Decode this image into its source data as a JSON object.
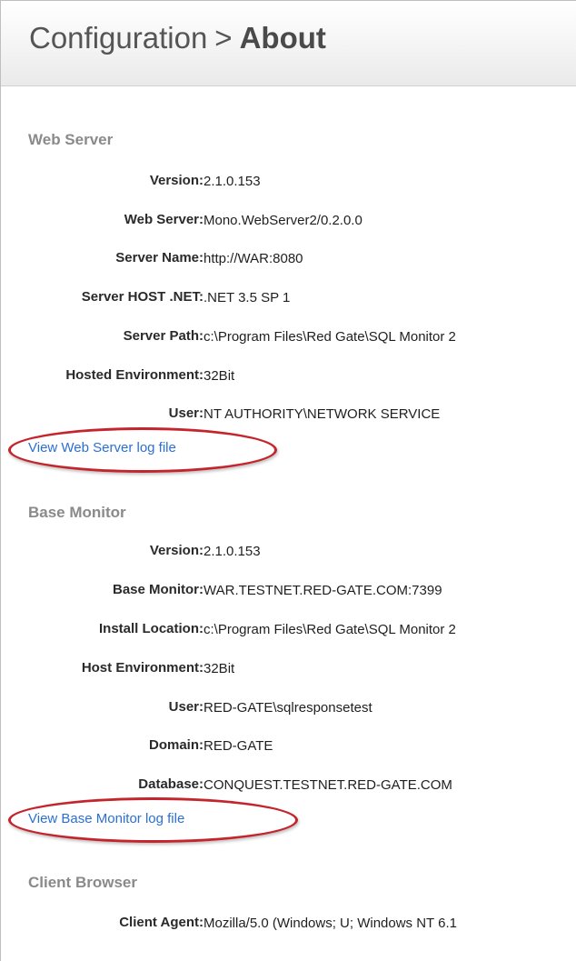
{
  "header": {
    "breadcrumb_parent": "Configuration",
    "breadcrumb_separator": ">",
    "breadcrumb_current": "About"
  },
  "web_server": {
    "title": "Web Server",
    "fields": [
      {
        "label": "Version:",
        "value": "2.1.0.153"
      },
      {
        "label": "Web Server:",
        "value": "Mono.WebServer2/0.2.0.0"
      },
      {
        "label": "Server Name:",
        "value": "http://WAR:8080"
      },
      {
        "label": "Server HOST .NET:",
        "value": ".NET 3.5 SP 1"
      },
      {
        "label": "Server Path:",
        "value": "c:\\Program Files\\Red Gate\\SQL Monitor 2"
      },
      {
        "label": "Hosted Environment:",
        "value": "32Bit"
      },
      {
        "label": "User:",
        "value": "NT AUTHORITY\\NETWORK SERVICE"
      }
    ],
    "log_link": "View Web Server log file"
  },
  "base_monitor": {
    "title": "Base Monitor",
    "fields": [
      {
        "label": "Version:",
        "value": "2.1.0.153"
      },
      {
        "label": "Base Monitor:",
        "value": "WAR.TESTNET.RED-GATE.COM:7399"
      },
      {
        "label": "Install Location:",
        "value": "c:\\Program Files\\Red Gate\\SQL Monitor 2"
      },
      {
        "label": "Host Environment:",
        "value": "32Bit"
      },
      {
        "label": "User:",
        "value": "RED-GATE\\sqlresponsetest"
      },
      {
        "label": "Domain:",
        "value": "RED-GATE"
      },
      {
        "label": "Database:",
        "value": "CONQUEST.TESTNET.RED-GATE.COM"
      }
    ],
    "log_link": "View Base Monitor log file"
  },
  "client_browser": {
    "title": "Client Browser",
    "fields": [
      {
        "label": "Client Agent:",
        "value": "Mozilla/5.0 (Windows; U; Windows NT 6.1"
      }
    ]
  },
  "colors": {
    "link": "#2a6fd6",
    "highlight_ellipse": "#c4242b",
    "section_title": "#8a8a8a"
  }
}
